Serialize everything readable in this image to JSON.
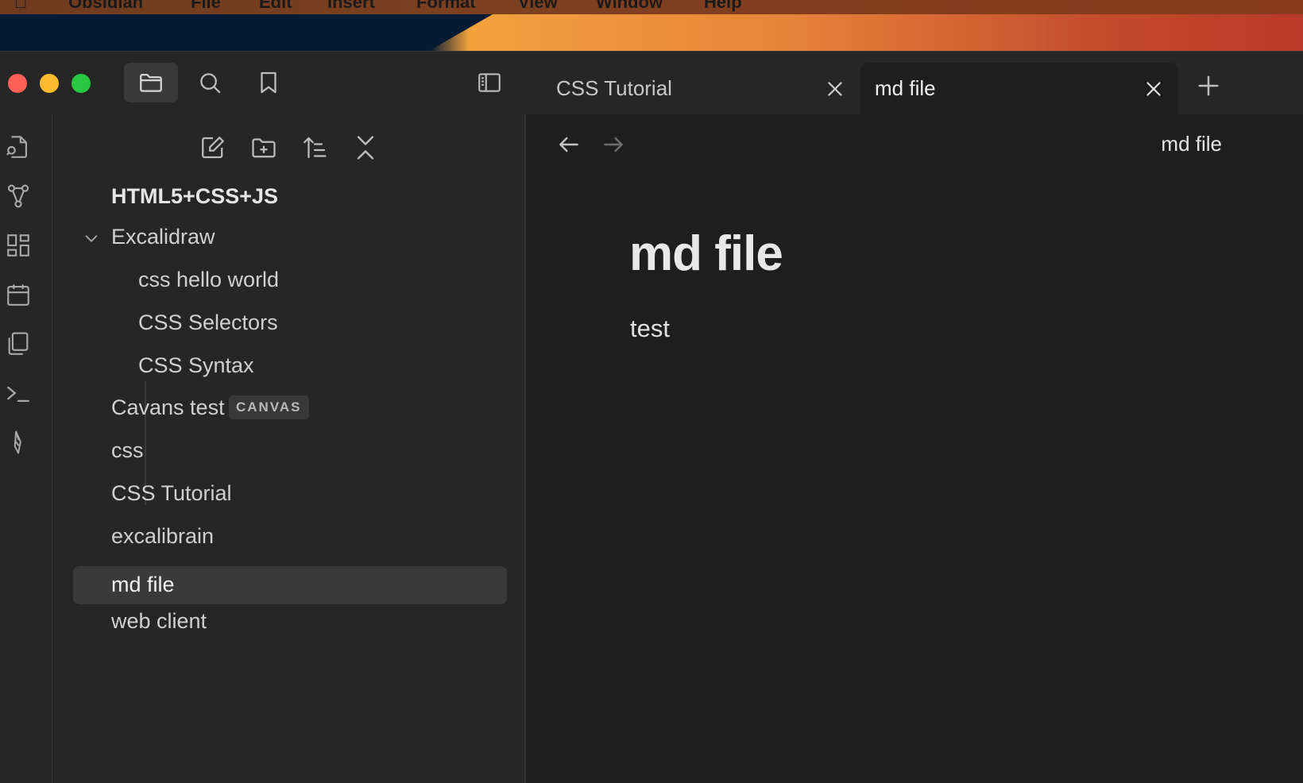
{
  "menubar": {
    "app_name": "Obsidian",
    "items": [
      "File",
      "Edit",
      "Insert",
      "Format",
      "View",
      "Window",
      "Help"
    ]
  },
  "colors": {
    "close": "#ff5f57",
    "minimize": "#febc2e",
    "zoom": "#28c840",
    "background": "#1e1e1e",
    "sidebar": "#262626",
    "selection": "#3a3a3a"
  },
  "toolbar": {
    "buttons": [
      "folder-icon",
      "search-icon",
      "bookmark-icon",
      "sidebar-toggle-icon"
    ]
  },
  "tabs": [
    {
      "label": "CSS Tutorial",
      "active": false
    },
    {
      "label": "md file",
      "active": true
    }
  ],
  "ribbon": {
    "icons": [
      "open-quick-switcher-icon",
      "graph-view-icon",
      "canvas-icon",
      "calendar-icon",
      "templates-icon",
      "command-palette-icon",
      "excalidraw-icon"
    ]
  },
  "sidebar": {
    "actions": [
      "new-note-icon",
      "new-folder-icon",
      "sort-icon",
      "collapse-all-icon"
    ],
    "root_folder": "HTML5+CSS+JS",
    "tree": [
      {
        "label": "Excalidraw",
        "type": "folder",
        "expanded": true
      },
      {
        "label": "css hello world",
        "type": "file",
        "depth": 1
      },
      {
        "label": "CSS Selectors",
        "type": "file",
        "depth": 1
      },
      {
        "label": "CSS Syntax",
        "type": "file",
        "depth": 1
      },
      {
        "label": "Cavans test",
        "type": "file",
        "badge": "CANVAS"
      },
      {
        "label": "css",
        "type": "file"
      },
      {
        "label": "CSS Tutorial",
        "type": "file"
      },
      {
        "label": "excalibrain",
        "type": "file"
      },
      {
        "label": "md file",
        "type": "file",
        "selected": true
      },
      {
        "label": "web client",
        "type": "file"
      }
    ]
  },
  "editor": {
    "view_title": "md file",
    "heading": "md file",
    "body": "test"
  }
}
